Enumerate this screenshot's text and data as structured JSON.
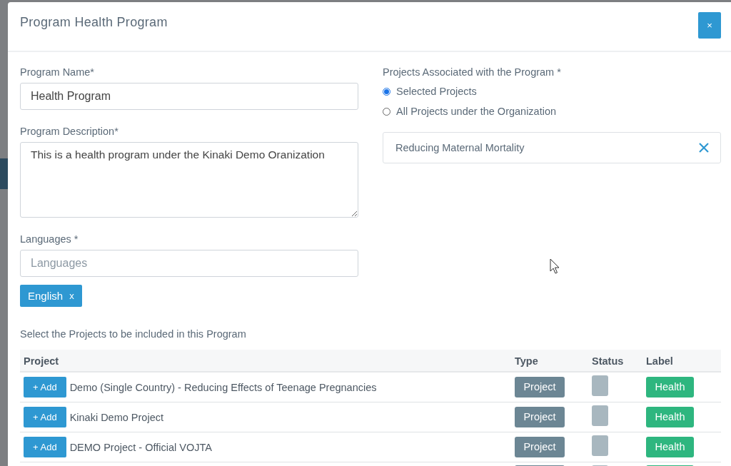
{
  "modal": {
    "title": "Program Health Program",
    "close": "×"
  },
  "form": {
    "name_label": "Program Name*",
    "name_value": "Health Program",
    "description_label": "Program Description*",
    "description_value": "This is a health program under the Kinaki Demo Oranization",
    "languages_label": "Languages *",
    "languages_placeholder": "Languages",
    "language_tags": [
      {
        "label": "English",
        "remove": "x"
      }
    ]
  },
  "association": {
    "label": "Projects Associated with the Program *",
    "options": [
      {
        "label": "Selected Projects",
        "selected": true
      },
      {
        "label": "All Projects under the Organization",
        "selected": false
      }
    ],
    "chosen_projects": [
      {
        "name": "Reducing Maternal Mortality"
      }
    ]
  },
  "projects_table": {
    "caption": "Select the Projects to be included in this Program",
    "columns": [
      "Project",
      "Type",
      "Status",
      "Label"
    ],
    "rows": [
      {
        "add": "+ Add",
        "project": "Demo (Single Country) - Reducing Effects of Teenage Pregnancies",
        "type": "Project",
        "label": "Health"
      },
      {
        "add": "+ Add",
        "project": "Kinaki Demo Project",
        "type": "Project",
        "label": "Health"
      },
      {
        "add": "+ Add",
        "project": "DEMO Project - Official VOJTA",
        "type": "Project",
        "label": "Health"
      },
      {}
    ]
  }
}
